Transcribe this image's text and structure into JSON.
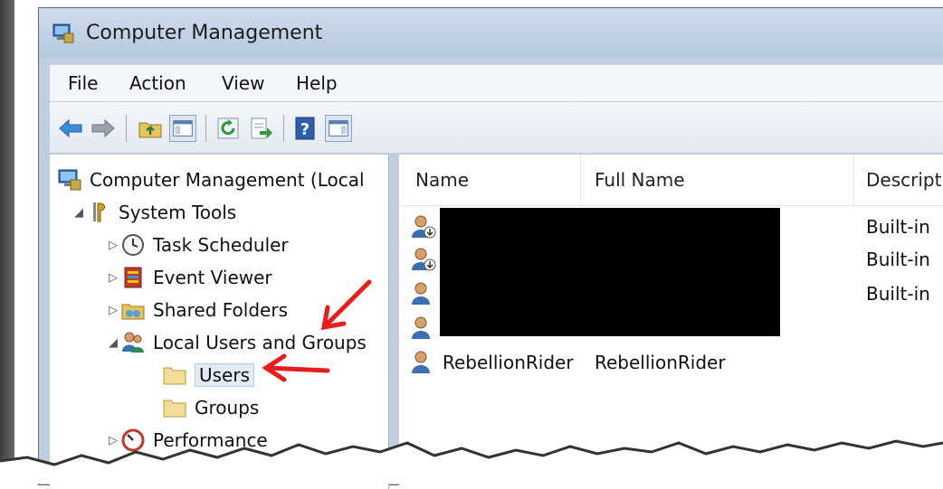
{
  "window": {
    "title": "Computer Management"
  },
  "menu": [
    "File",
    "Action",
    "View",
    "Help"
  ],
  "toolbar": {
    "buttons": [
      "back-arrow-icon",
      "forward-arrow-icon",
      "up-folder-icon",
      "show-hide-console-tree-icon",
      "refresh-icon",
      "export-list-icon",
      "help-icon",
      "show-hide-action-pane-icon"
    ]
  },
  "tree": {
    "root": "Computer Management (Local",
    "system_tools": "System Tools",
    "task_scheduler": "Task Scheduler",
    "event_viewer": "Event Viewer",
    "shared_folders": "Shared Folders",
    "local_users_groups": "Local Users and Groups",
    "users": "Users",
    "groups": "Groups",
    "performance": "Performance"
  },
  "list": {
    "columns": [
      "Name",
      "Full Name",
      "Descript"
    ],
    "rows": [
      {
        "name": "",
        "full_name": "",
        "description": "Built-in"
      },
      {
        "name": "",
        "full_name": "",
        "description": "Built-in"
      },
      {
        "name": "",
        "full_name": "",
        "description": "Built-in"
      },
      {
        "name": "",
        "full_name": "",
        "description": ""
      },
      {
        "name": "RebellionRider",
        "full_name": "RebellionRider",
        "description": ""
      }
    ]
  },
  "colors": {
    "annotation_arrow": "#e81c1c",
    "selection": "#e2ecf7",
    "window_frame": "#bfcfe0"
  }
}
